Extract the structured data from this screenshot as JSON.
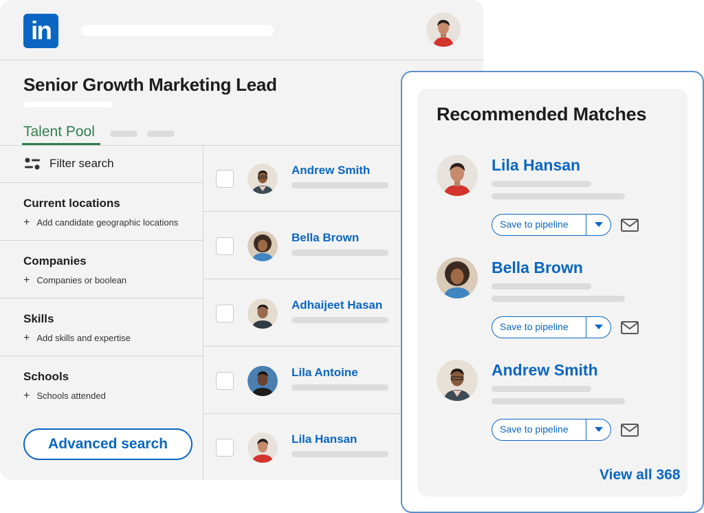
{
  "header": {
    "logo_text": "in",
    "job_title": "Senior Growth Marketing Lead",
    "active_tab": "Talent Pool"
  },
  "filters": {
    "filter_label": "Filter search",
    "sections": [
      {
        "title": "Current locations",
        "add_label": "Add candidate geographic locations"
      },
      {
        "title": "Companies",
        "add_label": "Companies or boolean"
      },
      {
        "title": "Skills",
        "add_label": "Add skills and expertise"
      },
      {
        "title": "Schools",
        "add_label": "Schools attended"
      }
    ],
    "advanced_button": "Advanced search"
  },
  "candidates": [
    {
      "name": "Andrew Smith"
    },
    {
      "name": "Bella Brown"
    },
    {
      "name": "Adhaijeet Hasan"
    },
    {
      "name": "Lila Antoine"
    },
    {
      "name": "Lila Hansan"
    }
  ],
  "recommended": {
    "title": "Recommended Matches",
    "matches": [
      {
        "name": "Lila Hansan",
        "button": "Save to pipeline"
      },
      {
        "name": "Bella Brown",
        "button": "Save to pipeline"
      },
      {
        "name": "Andrew Smith",
        "button": "Save to pipeline"
      }
    ],
    "view_all": "View all 368"
  },
  "icons": {
    "filter": "sliders-icon",
    "plus": "plus-icon",
    "dropdown": "caret-down-icon",
    "mail": "envelope-icon"
  },
  "colors": {
    "brand": "#0a66c2",
    "tab_active": "#2e7d4f",
    "panel_bg": "#f3f3f3",
    "card_border": "#5b8fc9"
  }
}
